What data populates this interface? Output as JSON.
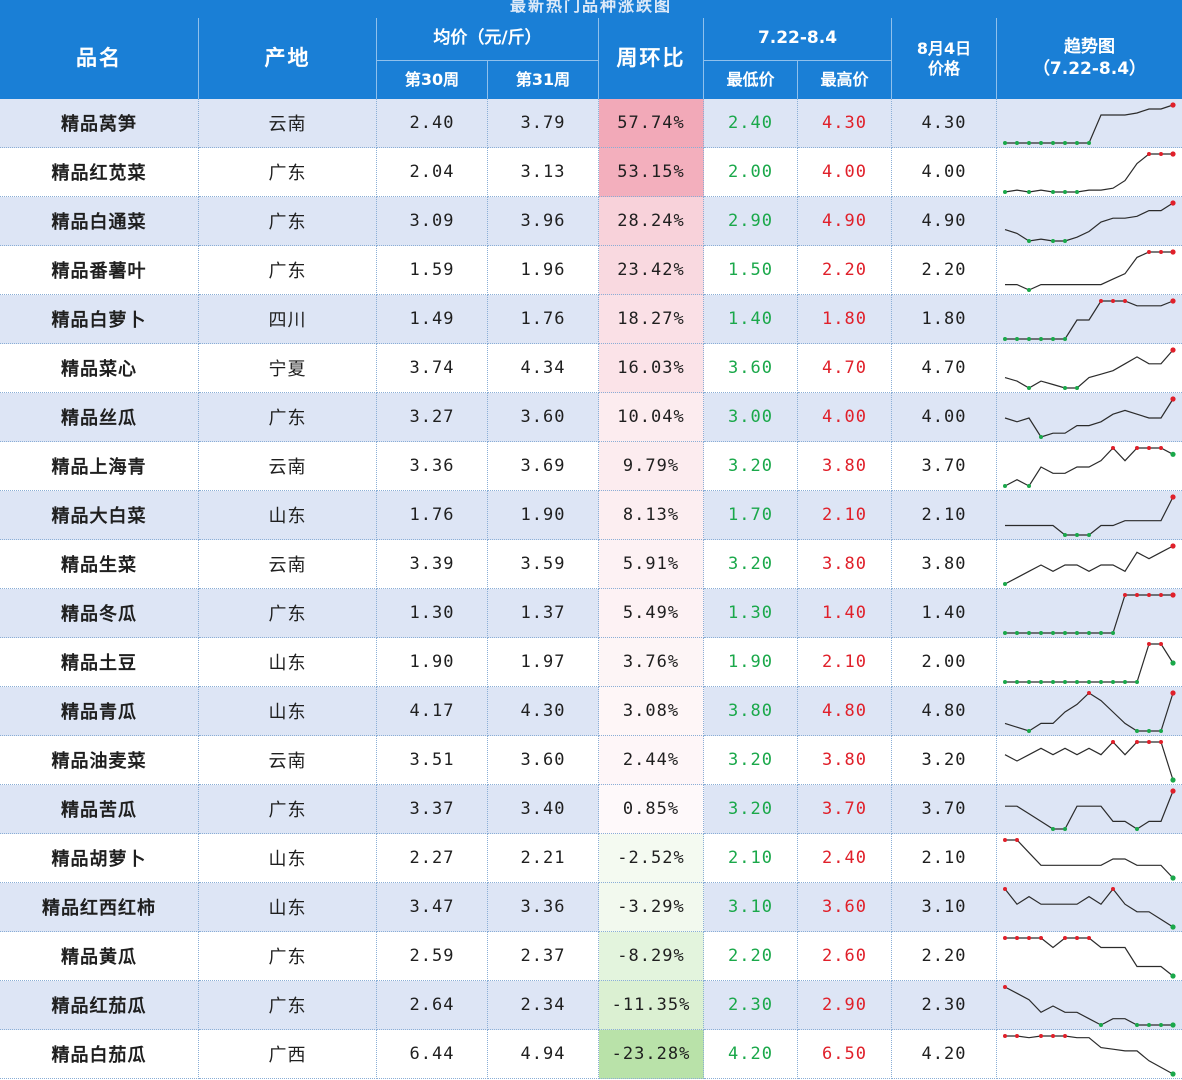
{
  "title": "最新热门品种涨跌图",
  "headers": {
    "name": "品名",
    "origin": "产地",
    "avg_price": "均价（元/斤）",
    "week30": "第30周",
    "week31": "第31周",
    "wow": "周环比",
    "range": "7.22-8.4",
    "min": "最低价",
    "max": "最高价",
    "aug4_line1": "8月4日",
    "aug4_line2": "价格",
    "trend_line1": "趋势图",
    "trend_line2": "（7.22-8.4）"
  },
  "colors": {
    "header_blue": "#1a7fd6",
    "row_alt": "#dde5f5",
    "low_green": "#1aa84a",
    "high_red": "#e0202a",
    "wow_positive_max": "#f2a9b8",
    "wow_negative_max": "#b9e2a9"
  },
  "rows": [
    {
      "name": "精品莴笋",
      "origin": "云南",
      "w30": "2.40",
      "w31": "3.79",
      "wow": "57.74%",
      "wow_value": 57.74,
      "min": "2.40",
      "max": "4.30",
      "aug4": "4.30",
      "trend": [
        2.4,
        2.4,
        2.4,
        2.4,
        2.4,
        2.4,
        2.4,
        2.4,
        3.8,
        3.8,
        3.8,
        3.9,
        4.1,
        4.1,
        4.3
      ]
    },
    {
      "name": "精品红苋菜",
      "origin": "广东",
      "w30": "2.04",
      "w31": "3.13",
      "wow": "53.15%",
      "wow_value": 53.15,
      "min": "2.00",
      "max": "4.00",
      "aug4": "4.00",
      "trend": [
        2.0,
        2.1,
        2.0,
        2.1,
        2.0,
        2.0,
        2.0,
        2.1,
        2.1,
        2.2,
        2.6,
        3.5,
        4.0,
        4.0,
        4.0
      ]
    },
    {
      "name": "精品白通菜",
      "origin": "广东",
      "w30": "3.09",
      "w31": "3.96",
      "wow": "28.24%",
      "wow_value": 28.24,
      "min": "2.90",
      "max": "4.90",
      "aug4": "4.90",
      "trend": [
        3.5,
        3.3,
        2.9,
        3.0,
        2.9,
        2.9,
        3.1,
        3.4,
        3.9,
        4.1,
        4.1,
        4.2,
        4.5,
        4.5,
        4.9
      ]
    },
    {
      "name": "精品番薯叶",
      "origin": "广东",
      "w30": "1.59",
      "w31": "1.96",
      "wow": "23.42%",
      "wow_value": 23.42,
      "min": "1.50",
      "max": "2.20",
      "aug4": "2.20",
      "trend": [
        1.6,
        1.6,
        1.5,
        1.6,
        1.6,
        1.6,
        1.6,
        1.6,
        1.6,
        1.7,
        1.8,
        2.1,
        2.2,
        2.2,
        2.2
      ]
    },
    {
      "name": "精品白萝卜",
      "origin": "四川",
      "w30": "1.49",
      "w31": "1.76",
      "wow": "18.27%",
      "wow_value": 18.27,
      "min": "1.40",
      "max": "1.80",
      "aug4": "1.80",
      "trend": [
        1.4,
        1.4,
        1.4,
        1.4,
        1.4,
        1.4,
        1.6,
        1.6,
        1.8,
        1.8,
        1.8,
        1.75,
        1.75,
        1.75,
        1.8
      ]
    },
    {
      "name": "精品菜心",
      "origin": "宁夏",
      "w30": "3.74",
      "w31": "4.34",
      "wow": "16.03%",
      "wow_value": 16.03,
      "min": "3.60",
      "max": "4.70",
      "aug4": "4.70",
      "trend": [
        3.9,
        3.8,
        3.6,
        3.8,
        3.7,
        3.6,
        3.6,
        3.9,
        4.0,
        4.1,
        4.3,
        4.5,
        4.3,
        4.3,
        4.7
      ]
    },
    {
      "name": "精品丝瓜",
      "origin": "广东",
      "w30": "3.27",
      "w31": "3.60",
      "wow": "10.04%",
      "wow_value": 10.04,
      "min": "3.00",
      "max": "4.00",
      "aug4": "4.00",
      "trend": [
        3.5,
        3.4,
        3.5,
        3.0,
        3.1,
        3.1,
        3.3,
        3.3,
        3.4,
        3.6,
        3.7,
        3.6,
        3.5,
        3.5,
        4.0
      ]
    },
    {
      "name": "精品上海青",
      "origin": "云南",
      "w30": "3.36",
      "w31": "3.69",
      "wow": "9.79%",
      "wow_value": 9.79,
      "min": "3.20",
      "max": "3.80",
      "aug4": "3.70",
      "trend": [
        3.2,
        3.3,
        3.2,
        3.5,
        3.4,
        3.4,
        3.5,
        3.5,
        3.6,
        3.8,
        3.6,
        3.8,
        3.8,
        3.8,
        3.7
      ]
    },
    {
      "name": "精品大白菜",
      "origin": "山东",
      "w30": "1.76",
      "w31": "1.90",
      "wow": "8.13%",
      "wow_value": 8.13,
      "min": "1.70",
      "max": "2.10",
      "aug4": "2.10",
      "trend": [
        1.8,
        1.8,
        1.8,
        1.8,
        1.8,
        1.7,
        1.7,
        1.7,
        1.8,
        1.8,
        1.85,
        1.85,
        1.85,
        1.85,
        2.1
      ]
    },
    {
      "name": "精品生菜",
      "origin": "云南",
      "w30": "3.39",
      "w31": "3.59",
      "wow": "5.91%",
      "wow_value": 5.91,
      "min": "3.20",
      "max": "3.80",
      "aug4": "3.80",
      "trend": [
        3.2,
        3.3,
        3.4,
        3.5,
        3.4,
        3.5,
        3.5,
        3.4,
        3.5,
        3.5,
        3.4,
        3.7,
        3.6,
        3.7,
        3.8
      ]
    },
    {
      "name": "精品冬瓜",
      "origin": "广东",
      "w30": "1.30",
      "w31": "1.37",
      "wow": "5.49%",
      "wow_value": 5.49,
      "min": "1.30",
      "max": "1.40",
      "aug4": "1.40",
      "trend": [
        1.3,
        1.3,
        1.3,
        1.3,
        1.3,
        1.3,
        1.3,
        1.3,
        1.3,
        1.3,
        1.4,
        1.4,
        1.4,
        1.4,
        1.4
      ]
    },
    {
      "name": "精品土豆",
      "origin": "山东",
      "w30": "1.90",
      "w31": "1.97",
      "wow": "3.76%",
      "wow_value": 3.76,
      "min": "1.90",
      "max": "2.10",
      "aug4": "2.00",
      "trend": [
        1.9,
        1.9,
        1.9,
        1.9,
        1.9,
        1.9,
        1.9,
        1.9,
        1.9,
        1.9,
        1.9,
        1.9,
        2.1,
        2.1,
        2.0
      ]
    },
    {
      "name": "精品青瓜",
      "origin": "山东",
      "w30": "4.17",
      "w31": "4.30",
      "wow": "3.08%",
      "wow_value": 3.08,
      "min": "3.80",
      "max": "4.80",
      "aug4": "4.80",
      "trend": [
        4.0,
        3.9,
        3.8,
        4.0,
        4.0,
        4.3,
        4.5,
        4.8,
        4.6,
        4.3,
        4.0,
        3.8,
        3.8,
        3.8,
        4.8
      ]
    },
    {
      "name": "精品油麦菜",
      "origin": "云南",
      "w30": "3.51",
      "w31": "3.60",
      "wow": "2.44%",
      "wow_value": 2.44,
      "min": "3.20",
      "max": "3.80",
      "aug4": "3.20",
      "trend": [
        3.6,
        3.5,
        3.6,
        3.7,
        3.6,
        3.7,
        3.6,
        3.7,
        3.6,
        3.8,
        3.6,
        3.8,
        3.8,
        3.8,
        3.2
      ]
    },
    {
      "name": "精品苦瓜",
      "origin": "广东",
      "w30": "3.37",
      "w31": "3.40",
      "wow": "0.85%",
      "wow_value": 0.85,
      "min": "3.20",
      "max": "3.70",
      "aug4": "3.70",
      "trend": [
        3.5,
        3.5,
        3.4,
        3.3,
        3.2,
        3.2,
        3.5,
        3.5,
        3.5,
        3.3,
        3.3,
        3.2,
        3.3,
        3.3,
        3.7
      ]
    },
    {
      "name": "精品胡萝卜",
      "origin": "山东",
      "w30": "2.27",
      "w31": "2.21",
      "wow": "-2.52%",
      "wow_value": -2.52,
      "min": "2.10",
      "max": "2.40",
      "aug4": "2.10",
      "trend": [
        2.4,
        2.4,
        2.3,
        2.2,
        2.2,
        2.2,
        2.2,
        2.2,
        2.2,
        2.25,
        2.25,
        2.2,
        2.2,
        2.2,
        2.1
      ]
    },
    {
      "name": "精品红西红柿",
      "origin": "山东",
      "w30": "3.47",
      "w31": "3.36",
      "wow": "-3.29%",
      "wow_value": -3.29,
      "min": "3.10",
      "max": "3.60",
      "aug4": "3.10",
      "trend": [
        3.6,
        3.4,
        3.5,
        3.4,
        3.4,
        3.4,
        3.4,
        3.5,
        3.4,
        3.6,
        3.4,
        3.3,
        3.3,
        3.2,
        3.1
      ]
    },
    {
      "name": "精品黄瓜",
      "origin": "广东",
      "w30": "2.59",
      "w31": "2.37",
      "wow": "-8.29%",
      "wow_value": -8.29,
      "min": "2.20",
      "max": "2.60",
      "aug4": "2.20",
      "trend": [
        2.6,
        2.6,
        2.6,
        2.6,
        2.5,
        2.6,
        2.6,
        2.6,
        2.5,
        2.5,
        2.5,
        2.3,
        2.3,
        2.3,
        2.2
      ]
    },
    {
      "name": "精品红茄瓜",
      "origin": "广东",
      "w30": "2.64",
      "w31": "2.34",
      "wow": "-11.35%",
      "wow_value": -11.35,
      "min": "2.30",
      "max": "2.90",
      "aug4": "2.30",
      "trend": [
        2.9,
        2.8,
        2.7,
        2.5,
        2.6,
        2.5,
        2.5,
        2.4,
        2.3,
        2.4,
        2.4,
        2.3,
        2.3,
        2.3,
        2.3
      ]
    },
    {
      "name": "精品白茄瓜",
      "origin": "广西",
      "w30": "6.44",
      "w31": "4.94",
      "wow": "-23.28%",
      "wow_value": -23.28,
      "min": "4.20",
      "max": "6.50",
      "aug4": "4.20",
      "trend": [
        6.5,
        6.5,
        6.4,
        6.5,
        6.5,
        6.5,
        6.4,
        6.4,
        5.8,
        5.7,
        5.6,
        5.6,
        5.0,
        4.6,
        4.2
      ]
    }
  ]
}
